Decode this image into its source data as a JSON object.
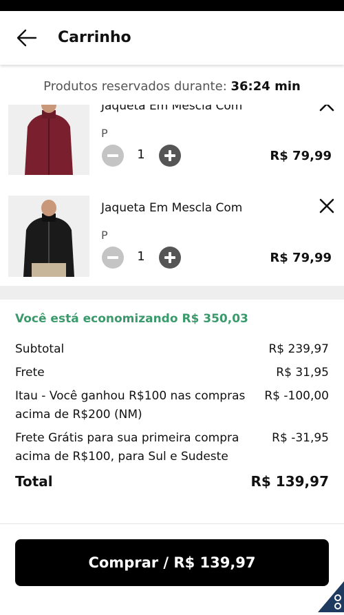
{
  "header": {
    "title": "Carrinho"
  },
  "timer": {
    "label": "Produtos reservados durante:",
    "value": "36:24 min"
  },
  "cart": {
    "items": [
      {
        "name": "Jaqueta Em Mescla Com",
        "size": "P",
        "quantity": "1",
        "price": "R$ 79,99",
        "color": "#7a1f2e"
      },
      {
        "name": "Jaqueta Em Mescla Com",
        "size": "P",
        "quantity": "1",
        "price": "R$ 79,99",
        "color": "#1a1a1a"
      }
    ]
  },
  "summary": {
    "savings": "Você está economizando R$ 350,03",
    "rows": [
      {
        "label": "Subtotal",
        "value": "R$ 239,97"
      },
      {
        "label": "Frete",
        "value": "R$ 31,95"
      },
      {
        "label": "Itau - Você ganhou R$100 nas compras acima de R$200 (NM)",
        "value": "R$ -100,00"
      },
      {
        "label": "Frete Grátis para sua primeira compra acima de R$100, para Sul e Sudeste",
        "value": "R$ -31,95"
      }
    ],
    "total": {
      "label": "Total",
      "value": "R$ 139,97"
    }
  },
  "footer": {
    "buy_label": "Comprar / R$ 139,97"
  },
  "colors": {
    "accent_green": "#3a9a6b",
    "button": "#000000"
  },
  "icons": {
    "back": "arrow-left-icon",
    "remove": "close-icon",
    "minus": "minus-icon",
    "plus": "plus-icon"
  }
}
